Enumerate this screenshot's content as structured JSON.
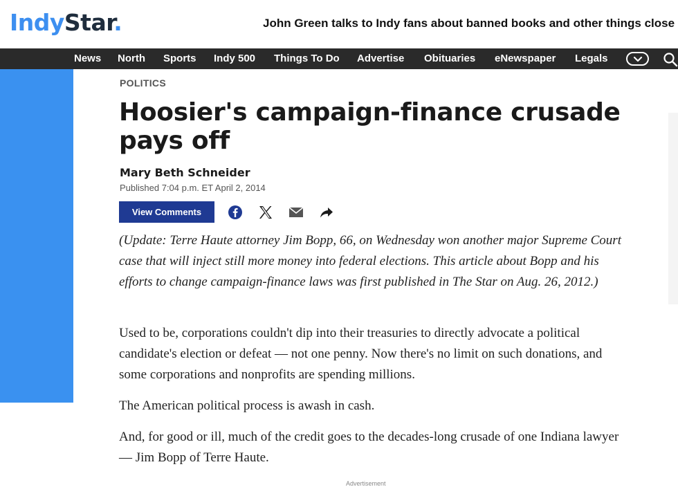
{
  "brand": {
    "logo_part1": "Indy",
    "logo_part2": "Star",
    "logo_dot": "."
  },
  "header": {
    "ticker": "John Green talks to Indy fans about banned books and other things close"
  },
  "nav": {
    "items": [
      "News",
      "North",
      "Sports",
      "Indy 500",
      "Things To Do",
      "Advertise",
      "Obituaries",
      "eNewspaper",
      "Legals"
    ],
    "more_icon": "chevron-down-icon",
    "search_icon": "search-icon"
  },
  "article": {
    "section": "POLITICS",
    "title": "Hoosier's campaign-finance crusade pays off",
    "author": "Mary Beth Schneider",
    "published": "Published 7:04 p.m. ET April 2, 2014",
    "view_comments": "View Comments",
    "share_icons": [
      "facebook-icon",
      "x-icon",
      "email-icon",
      "share-icon"
    ],
    "paragraphs": [
      "(Update: Terre Haute attorney Jim Bopp, 66, on Wednesday won another major Supreme Court case that will inject still more money into federal elections. This article about Bopp and his efforts to change campaign-finance laws was first published in The Star on Aug. 26, 2012.)",
      "Used to be, corporations couldn't dip into their treasuries to directly advocate a political candidate's election or defeat — not one penny. Now there's no limit on such donations, and some corporations and nonprofits are spending millions.",
      "The American political process is awash in cash.",
      "And, for good or ill, much of the credit goes to the decades-long crusade of one Indiana lawyer — Jim Bopp of Terre Haute."
    ],
    "ad_label": "Advertisement"
  },
  "colors": {
    "brand_blue": "#3d8ff0",
    "nav_bg": "#2a2a2a",
    "button_blue": "#1f3a93",
    "left_bar": "#3a91f0"
  }
}
